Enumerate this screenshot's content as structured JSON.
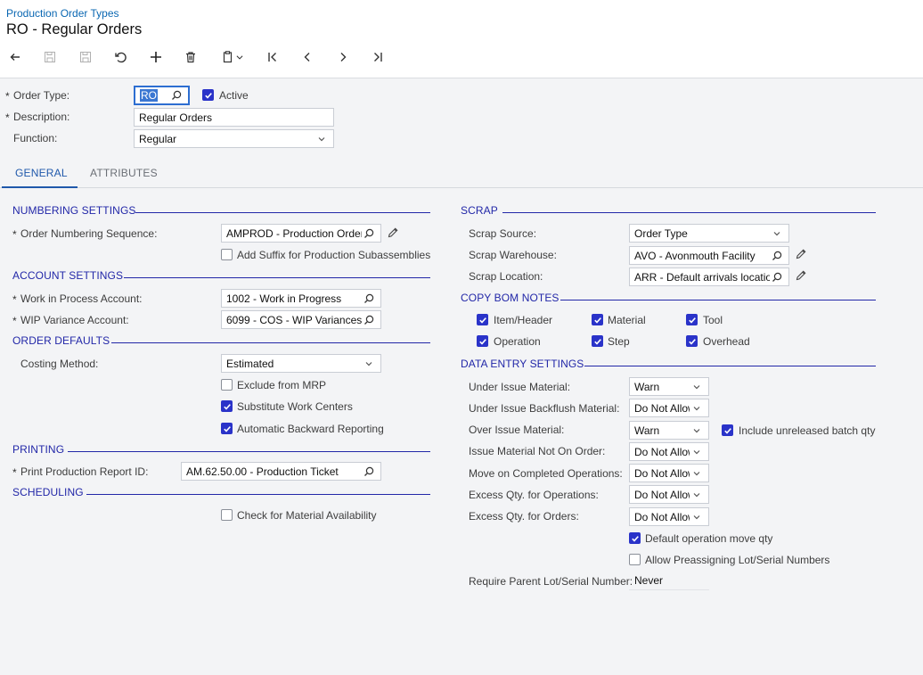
{
  "header": {
    "breadcrumb": "Production Order Types",
    "title": "RO - Regular Orders"
  },
  "toolbar": [
    {
      "name": "undo-back-button",
      "icon": "arrow-left-icon"
    },
    {
      "name": "save-close-button",
      "icon": "save-close-icon"
    },
    {
      "name": "save-button",
      "icon": "save-icon"
    },
    {
      "name": "cancel-button",
      "icon": "undo-icon"
    },
    {
      "name": "add-button",
      "icon": "plus-icon"
    },
    {
      "name": "delete-button",
      "icon": "trash-icon"
    },
    {
      "name": "clipboard-button",
      "icon": "clipboard-icon"
    },
    {
      "name": "first-record-button",
      "icon": "first-icon"
    },
    {
      "name": "prev-record-button",
      "icon": "prev-icon"
    },
    {
      "name": "next-record-button",
      "icon": "next-icon"
    },
    {
      "name": "last-record-button",
      "icon": "last-icon"
    }
  ],
  "form": {
    "order_type_label": "Order Type:",
    "order_type_value": "RO",
    "active_label": "Active",
    "active_checked": true,
    "description_label": "Description:",
    "description_value": "Regular Orders",
    "function_label": "Function:",
    "function_value": "Regular"
  },
  "tabs": [
    {
      "label": "GENERAL",
      "active": true
    },
    {
      "label": "ATTRIBUTES",
      "active": false
    }
  ],
  "left": {
    "numbering": {
      "title": "NUMBERING SETTINGS",
      "seq_label": "Order Numbering Sequence:",
      "seq_value": "AMPROD - Production Order",
      "suffix_label": "Add Suffix for Production Subassemblies",
      "suffix_checked": false
    },
    "account": {
      "title": "ACCOUNT SETTINGS",
      "wip_label": "Work in Process Account:",
      "wip_value": "1002 - Work in Progress",
      "var_label": "WIP Variance Account:",
      "var_value": "6099 - COS - WIP Variances"
    },
    "defaults": {
      "title": "ORDER DEFAULTS",
      "costing_label": "Costing Method:",
      "costing_value": "Estimated",
      "exclude_label": "Exclude from MRP",
      "exclude_checked": false,
      "substitute_label": "Substitute Work Centers",
      "substitute_checked": true,
      "backward_label": "Automatic Backward Reporting",
      "backward_checked": true
    },
    "printing": {
      "title": "PRINTING",
      "report_label": "Print Production Report ID:",
      "report_value": "AM.62.50.00 - Production Ticket"
    },
    "scheduling": {
      "title": "SCHEDULING",
      "check_label": "Check for Material Availability",
      "check_checked": false
    }
  },
  "right": {
    "scrap": {
      "title": "SCRAP",
      "source_label": "Scrap Source:",
      "source_value": "Order Type",
      "warehouse_label": "Scrap Warehouse:",
      "warehouse_value": "AVO - Avonmouth Facility",
      "location_label": "Scrap Location:",
      "location_value": "ARR - Default arrivals location"
    },
    "bom": {
      "title": "COPY BOM NOTES",
      "items": [
        {
          "label": "Item/Header",
          "checked": true
        },
        {
          "label": "Material",
          "checked": true
        },
        {
          "label": "Tool",
          "checked": true
        },
        {
          "label": "Operation",
          "checked": true
        },
        {
          "label": "Step",
          "checked": true
        },
        {
          "label": "Overhead",
          "checked": true
        }
      ]
    },
    "entry": {
      "title": "DATA ENTRY SETTINGS",
      "rows": [
        {
          "label": "Under Issue Material:",
          "value": "Warn"
        },
        {
          "label": "Under Issue Backflush Material:",
          "value": "Do Not Allow"
        },
        {
          "label": "Over Issue Material:",
          "value": "Warn"
        },
        {
          "label": "Issue Material Not On Order:",
          "value": "Do Not Allow"
        },
        {
          "label": "Move on Completed Operations:",
          "value": "Do Not Allow"
        },
        {
          "label": "Excess Qty. for Operations:",
          "value": "Do Not Allow"
        },
        {
          "label": "Excess Qty. for Orders:",
          "value": "Do Not Allow"
        }
      ],
      "unreleased_label": "Include unreleased batch qty",
      "unreleased_checked": true,
      "default_move_label": "Default operation move qty",
      "default_move_checked": true,
      "preassign_label": "Allow Preassigning Lot/Serial Numbers",
      "preassign_checked": false,
      "parent_lot_label": "Require Parent Lot/Serial Number:",
      "parent_lot_value": "Never"
    }
  },
  "colors": {
    "accent": "#2227a8",
    "link": "#0a67b2",
    "checkbox": "#2a33c9"
  }
}
